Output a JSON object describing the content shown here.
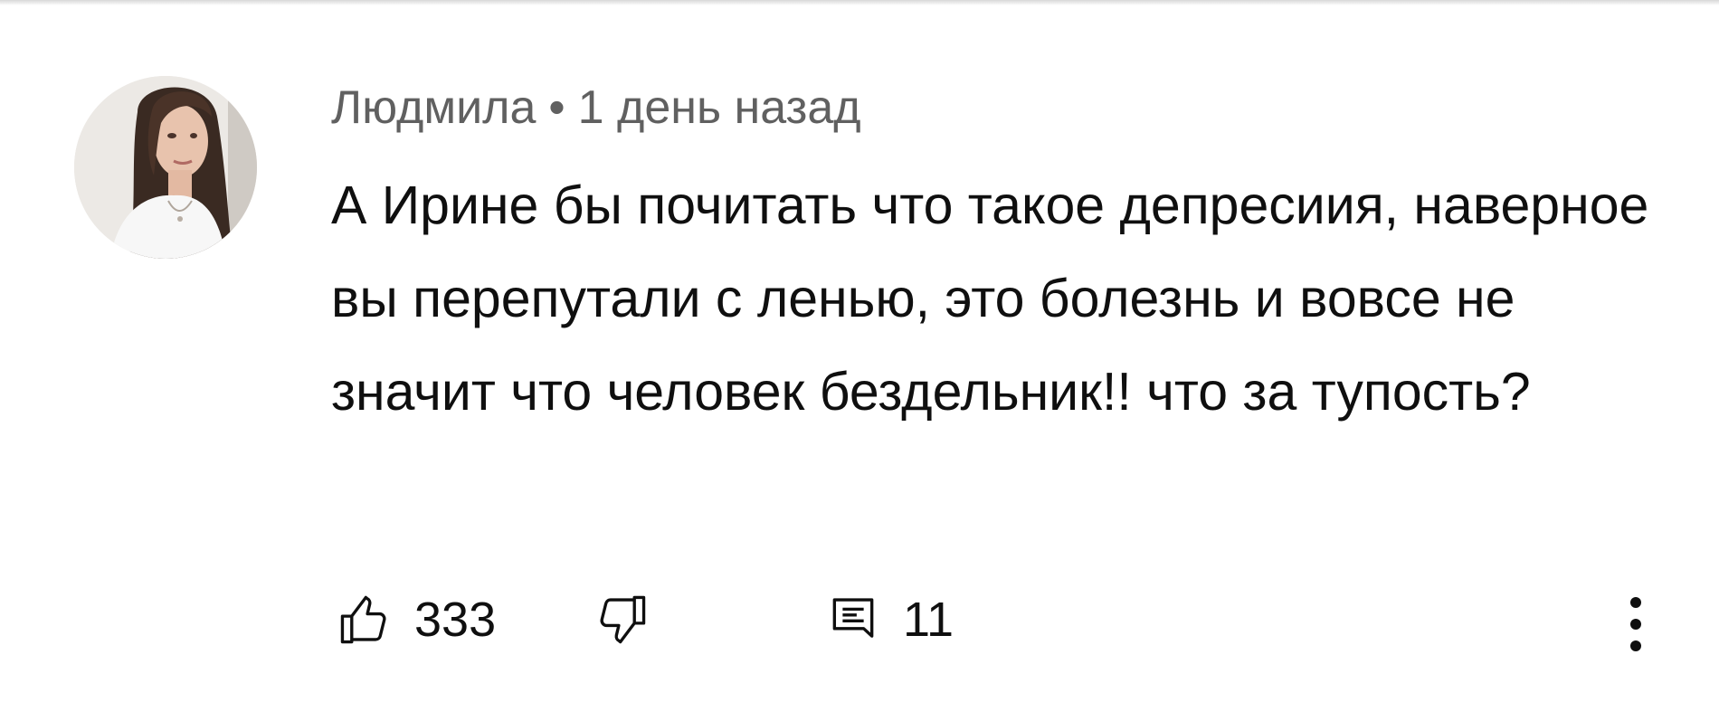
{
  "comment": {
    "author": "Людмила",
    "separator": "•",
    "time": "1 день назад",
    "text": "А Ирине бы почитать что такое депресиия, наверное вы перепутали с ленью, это болезнь и вовсе не значит что человек бездельник!! что за тупость?",
    "likes": "333",
    "replies": "11"
  },
  "icons": {
    "like": "thumbs-up-icon",
    "dislike": "thumbs-down-icon",
    "reply": "reply-comment-icon",
    "more": "more-vertical-icon"
  },
  "colors": {
    "meta_text": "#606060",
    "body_text": "#0f0f0f",
    "background": "#ffffff"
  }
}
